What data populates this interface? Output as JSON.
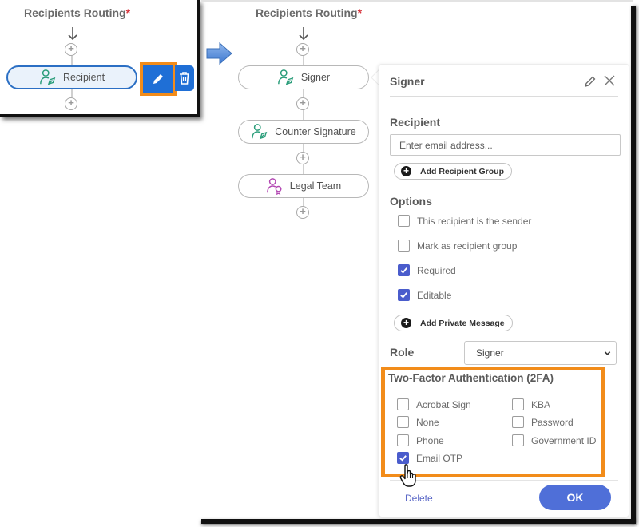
{
  "before": {
    "title": "Recipients Routing",
    "required_marker": "*",
    "node": {
      "label": "Recipient",
      "icon": "user-sign-icon"
    },
    "actions": {
      "edit": "pencil-icon",
      "delete": "trash-icon"
    }
  },
  "after": {
    "title": "Recipients Routing",
    "required_marker": "*",
    "nodes": [
      {
        "label": "Signer",
        "icon": "user-sign-icon",
        "color": "#2a9d7a"
      },
      {
        "label": "Counter Signature",
        "icon": "user-sign-icon",
        "color": "#2a9d7a"
      },
      {
        "label": "Legal Team",
        "icon": "user-badge-icon",
        "color": "#b349b3"
      }
    ]
  },
  "panel": {
    "title": "Signer",
    "recipient": {
      "label": "Recipient",
      "email_placeholder": "Enter email address...",
      "email_value": "",
      "add_group_label": "Add Recipient Group"
    },
    "options": {
      "label": "Options",
      "items": [
        {
          "label": "This recipient is the sender",
          "checked": false
        },
        {
          "label": "Mark as recipient group",
          "checked": false
        },
        {
          "label": "Required",
          "checked": true
        },
        {
          "label": "Editable",
          "checked": true
        }
      ],
      "add_message_label": "Add Private Message"
    },
    "role": {
      "label": "Role",
      "selected": "Signer"
    },
    "two_factor": {
      "label": "Two-Factor Authentication (2FA)",
      "left": [
        {
          "label": "Acrobat Sign",
          "checked": false
        },
        {
          "label": "None",
          "checked": false
        },
        {
          "label": "Phone",
          "checked": false
        },
        {
          "label": "Email OTP",
          "checked": true
        }
      ],
      "right": [
        {
          "label": "KBA",
          "checked": false
        },
        {
          "label": "Password",
          "checked": false
        },
        {
          "label": "Government ID",
          "checked": false
        }
      ]
    },
    "footer": {
      "delete_label": "Delete",
      "ok_label": "OK"
    }
  },
  "colors": {
    "highlight": "#f28c1a",
    "primary": "#4f6fd8",
    "checkbox": "#4a5ccc",
    "edit_button": "#1f6fd6",
    "required": "#d7373f"
  }
}
